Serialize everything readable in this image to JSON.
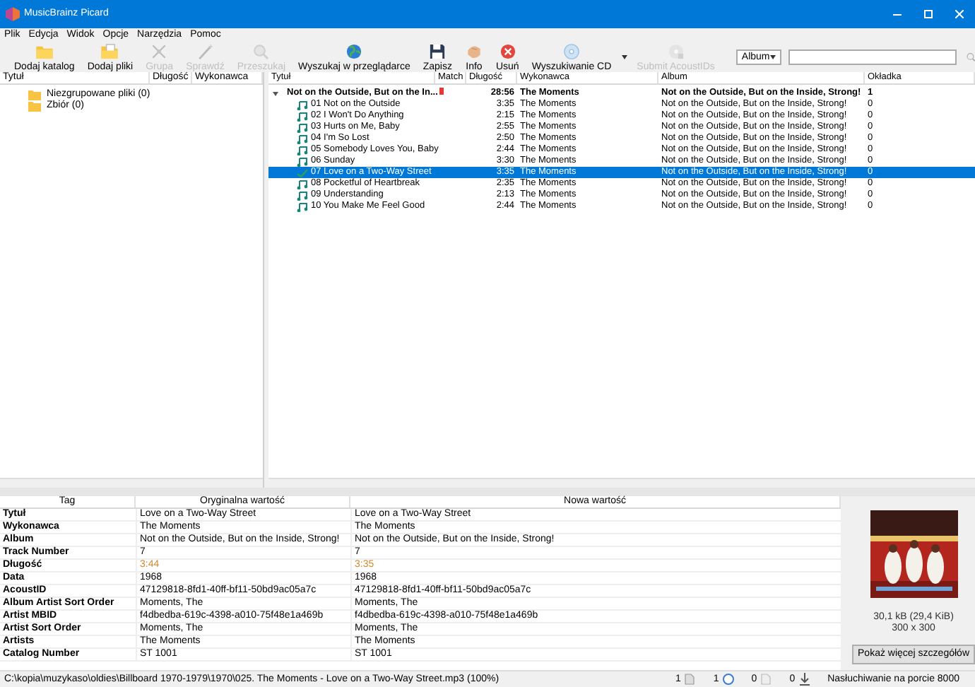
{
  "window": {
    "title": "MusicBrainz Picard"
  },
  "menu": [
    "Plik",
    "Edycja",
    "Widok",
    "Opcje",
    "Narzędzia",
    "Pomoc"
  ],
  "toolbar": [
    {
      "kind": "folder",
      "label": "Dodaj katalog",
      "disabled": false
    },
    {
      "kind": "files",
      "label": "Dodaj pliki",
      "disabled": false
    },
    {
      "kind": "cluster",
      "label": "Grupa",
      "disabled": true
    },
    {
      "kind": "wand",
      "label": "Sprawdź",
      "disabled": true
    },
    {
      "kind": "scan",
      "label": "Przeszukaj",
      "disabled": true
    },
    {
      "kind": "globe",
      "label": "Wyszukaj w przeglądarce",
      "disabled": false
    },
    {
      "kind": "save",
      "label": "Zapisz",
      "disabled": false
    },
    {
      "kind": "info",
      "label": "Info",
      "disabled": false
    },
    {
      "kind": "remove",
      "label": "Usuń",
      "disabled": false
    },
    {
      "kind": "cd",
      "label": "Wyszukiwanie CD",
      "disabled": false
    },
    {
      "kind": "acoustid",
      "label": "Submit AcoustIDs",
      "disabled": true
    }
  ],
  "search": {
    "mode": "Album"
  },
  "left_pane": {
    "columns": [
      "Tytuł",
      "Długość",
      "Wykonawca"
    ],
    "items": [
      {
        "label": "Niezgrupowane pliki (0)"
      },
      {
        "label": "Zbiór (0)"
      }
    ]
  },
  "right_pane": {
    "columns": [
      "Tytuł",
      "Match",
      "Długość",
      "Wykonawca",
      "Album",
      "Okładka"
    ],
    "album": {
      "title": "Not on the Outside, But on the In...",
      "expanded": true,
      "length": "28:56",
      "artist": "The Moments",
      "album": "Not on the Outside, But on the Inside, Strong!",
      "cover": "1"
    },
    "tracks": [
      {
        "number": "01",
        "title": "Not on the Outside",
        "length": "3:35",
        "artist": "The Moments",
        "album": "Not on the Outside, But on the Inside, Strong!",
        "cover": "0",
        "selected": false
      },
      {
        "number": "02",
        "title": "I Won't Do Anything",
        "length": "2:15",
        "artist": "The Moments",
        "album": "Not on the Outside, But on the Inside, Strong!",
        "cover": "0",
        "selected": false
      },
      {
        "number": "03",
        "title": "Hurts on Me, Baby",
        "length": "2:55",
        "artist": "The Moments",
        "album": "Not on the Outside, But on the Inside, Strong!",
        "cover": "0",
        "selected": false
      },
      {
        "number": "04",
        "title": "I'm So Lost",
        "length": "2:50",
        "artist": "The Moments",
        "album": "Not on the Outside, But on the Inside, Strong!",
        "cover": "0",
        "selected": false
      },
      {
        "number": "05",
        "title": "Somebody Loves You, Baby",
        "length": "2:44",
        "artist": "The Moments",
        "album": "Not on the Outside, But on the Inside, Strong!",
        "cover": "0",
        "selected": false
      },
      {
        "number": "06",
        "title": "Sunday",
        "length": "3:30",
        "artist": "The Moments",
        "album": "Not on the Outside, But on the Inside, Strong!",
        "cover": "0",
        "selected": false
      },
      {
        "number": "07",
        "title": "Love on a Two-Way Street",
        "length": "3:35",
        "artist": "The Moments",
        "album": "Not on the Outside, But on the Inside, Strong!",
        "cover": "0",
        "selected": true
      },
      {
        "number": "08",
        "title": "Pocketful of Heartbreak",
        "length": "2:35",
        "artist": "The Moments",
        "album": "Not on the Outside, But on the Inside, Strong!",
        "cover": "0",
        "selected": false
      },
      {
        "number": "09",
        "title": "Understanding",
        "length": "2:13",
        "artist": "The Moments",
        "album": "Not on the Outside, But on the Inside, Strong!",
        "cover": "0",
        "selected": false
      },
      {
        "number": "10",
        "title": "You Make Me Feel Good",
        "length": "2:44",
        "artist": "The Moments",
        "album": "Not on the Outside, But on the Inside, Strong!",
        "cover": "0",
        "selected": false
      }
    ]
  },
  "tag_table": {
    "columns": [
      "Tag",
      "Oryginalna wartość",
      "Nowa wartość"
    ],
    "rows": [
      {
        "tag": "Tytuł",
        "original": "Love on a Two-Way Street",
        "new": "Love on a Two-Way Street",
        "changed": false
      },
      {
        "tag": "Wykonawca",
        "original": "The Moments",
        "new": "The Moments",
        "changed": false
      },
      {
        "tag": "Album",
        "original": "Not on the Outside, But on the Inside, Strong!",
        "new": "Not on the Outside, But on the Inside, Strong!",
        "changed": false
      },
      {
        "tag": "Track Number",
        "original": "7",
        "new": "7",
        "changed": false
      },
      {
        "tag": "Długość",
        "original": "3:44",
        "new": "3:35",
        "changed": true
      },
      {
        "tag": "Data",
        "original": "1968",
        "new": "1968",
        "changed": false
      },
      {
        "tag": "AcoustID",
        "original": "47129818-8fd1-40ff-bf11-50bd9ac05a7c",
        "new": "47129818-8fd1-40ff-bf11-50bd9ac05a7c",
        "changed": false
      },
      {
        "tag": "Album Artist Sort Order",
        "original": "Moments, The",
        "new": "Moments, The",
        "changed": false
      },
      {
        "tag": "Artist MBID",
        "original": "f4dbedba-619c-4398-a010-75f48e1a469b",
        "new": "f4dbedba-619c-4398-a010-75f48e1a469b",
        "changed": false
      },
      {
        "tag": "Artist Sort Order",
        "original": "Moments, The",
        "new": "Moments, The",
        "changed": false
      },
      {
        "tag": "Artists",
        "original": "The Moments",
        "new": "The Moments",
        "changed": false
      },
      {
        "tag": "Catalog Number",
        "original": "ST 1001",
        "new": "ST 1001",
        "changed": false
      }
    ]
  },
  "cover_panel": {
    "size": "30,1 kB (29,4 KiB)",
    "dimensions": "300 x 300",
    "button": "Pokaż więcej szczegółów"
  },
  "status_bar": {
    "path": "C:\\kopia\\muzykaso\\oldies\\Billboard 1970-1979\\1970\\025. The Moments - Love on a Two-Way Street.mp3 (100%)",
    "counters": [
      {
        "kind": "files",
        "value": "1"
      },
      {
        "kind": "albums",
        "value": "1"
      },
      {
        "kind": "pending",
        "value": "0"
      },
      {
        "kind": "downloads",
        "value": "0"
      }
    ],
    "message": "Nasłuchiwanie na porcie 8000"
  }
}
